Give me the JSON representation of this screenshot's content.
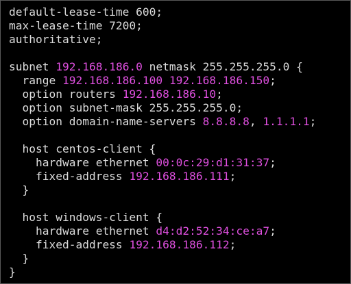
{
  "theme": {
    "background": "#000000",
    "text": "#dcdcdc",
    "highlight": "#e050e0",
    "border": "#5a5a5a"
  },
  "lines": [
    [
      {
        "t": "default-lease-time 600;"
      }
    ],
    [
      {
        "t": "max-lease-time 7200;"
      }
    ],
    [
      {
        "t": "authoritative;"
      }
    ],
    [],
    [
      {
        "t": "subnet "
      },
      {
        "t": "192.168.186.0",
        "h": true
      },
      {
        "t": " netmask 255.255.255.0 {"
      }
    ],
    [
      {
        "t": "  range "
      },
      {
        "t": "192.168.186.100",
        "h": true
      },
      {
        "t": " "
      },
      {
        "t": "192.168.186.150",
        "h": true
      },
      {
        "t": ";"
      }
    ],
    [
      {
        "t": "  option routers "
      },
      {
        "t": "192.168.186.10",
        "h": true
      },
      {
        "t": ";"
      }
    ],
    [
      {
        "t": "  option subnet-mask 255.255.255.0;"
      }
    ],
    [
      {
        "t": "  option domain-name-servers "
      },
      {
        "t": "8.8.8.8",
        "h": true
      },
      {
        "t": ", "
      },
      {
        "t": "1.1.1.1",
        "h": true
      },
      {
        "t": ";"
      }
    ],
    [],
    [
      {
        "t": "  host centos-client {"
      }
    ],
    [
      {
        "t": "    hardware ethernet "
      },
      {
        "t": "00:0c:29:d1:31:37",
        "h": true
      },
      {
        "t": ";"
      }
    ],
    [
      {
        "t": "    fixed-address "
      },
      {
        "t": "192.168.186.111",
        "h": true
      },
      {
        "t": ";"
      }
    ],
    [
      {
        "t": "  }"
      }
    ],
    [],
    [
      {
        "t": "  host windows-client {"
      }
    ],
    [
      {
        "t": "    hardware ethernet "
      },
      {
        "t": "d4:d2:52:34:ce:a7",
        "h": true
      },
      {
        "t": ";"
      }
    ],
    [
      {
        "t": "    fixed-address "
      },
      {
        "t": "192.168.186.112",
        "h": true
      },
      {
        "t": ";"
      }
    ],
    [
      {
        "t": "  }"
      }
    ],
    [
      {
        "t": "}"
      }
    ]
  ]
}
